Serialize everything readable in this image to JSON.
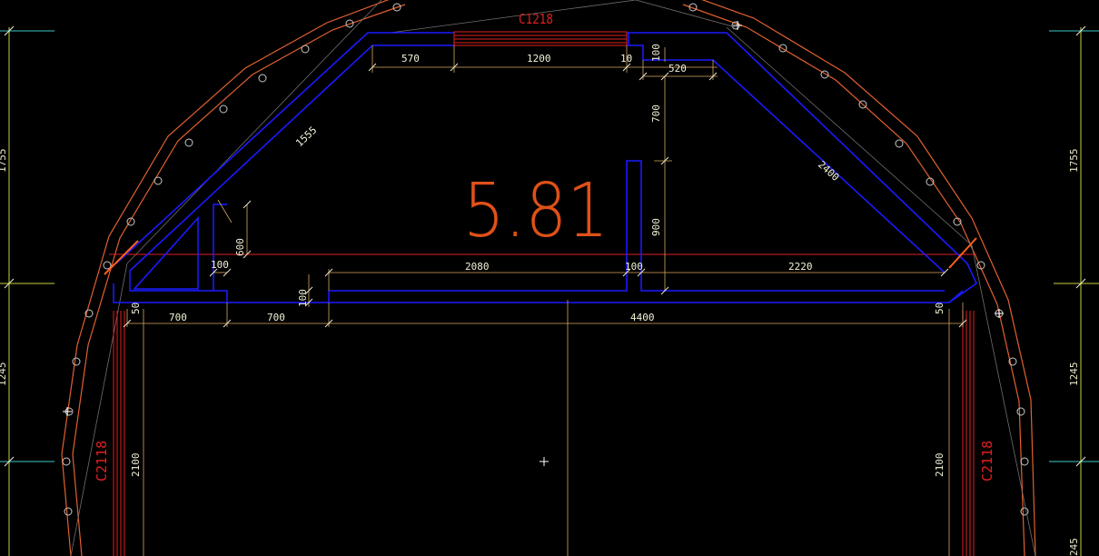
{
  "window_labels": {
    "top": "C1218",
    "left": "C2118",
    "right": "C2118"
  },
  "floor_level": "5.81",
  "dimensions": {
    "d570": "570",
    "d1200": "1200",
    "d10": "10",
    "d100_top": "100",
    "d520": "520",
    "d700_vert": "700",
    "d1555": "1555",
    "d2400": "2400",
    "d900": "900",
    "d600": "600",
    "d100_a": "100",
    "d2080": "2080",
    "d100_b": "100",
    "d2220": "2220",
    "d100_c": "100",
    "d50_left": "50",
    "d700_a": "700",
    "d700_b": "700",
    "d4400": "4400",
    "d50_right": "50",
    "d2100_left": "2100",
    "d2100_right": "2100",
    "right_1755": "1755",
    "right_1245": "1245",
    "right_245": "245",
    "left_1755": "1755",
    "left_1245": "1245"
  },
  "colors": {
    "background": "#000000",
    "wall": "#1a1aff",
    "hull": "#e06030",
    "dimension": "#d8a860",
    "window": "#e02020",
    "text": "#f2f2d8",
    "axis": "#c8d040"
  }
}
